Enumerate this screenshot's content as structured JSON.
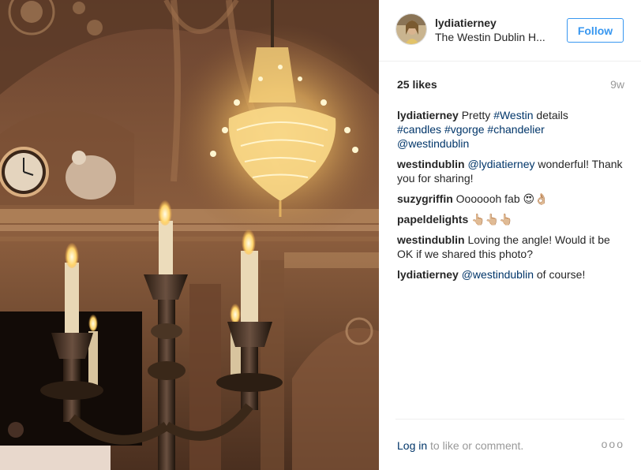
{
  "post": {
    "author": "lydiatierney",
    "location": "The Westin Dublin H...",
    "follow_label": "Follow",
    "likes": "25 likes",
    "age": "9w"
  },
  "caption": {
    "user": "lydiatierney",
    "text_pre": " Pretty ",
    "tag1": "#Westin",
    "text_mid": " details",
    "tag2": "#candles",
    "tag3": "#vgorge",
    "tag4": "#chandelier",
    "mention": "@westindublin"
  },
  "comments": [
    {
      "user": "westindublin",
      "mention": "@lydiatierney",
      "text": " wonderful! Thank you for sharing!"
    },
    {
      "user": "suzygriffin",
      "mention": "",
      "text": " Ooooooh fab 😍👌🏼"
    },
    {
      "user": "papeldelights",
      "mention": "",
      "text": " 👆🏼👆🏼👆🏼"
    },
    {
      "user": "westindublin",
      "mention": "",
      "text": " Loving the angle! Would it be OK if we shared this photo?"
    },
    {
      "user": "lydiatierney",
      "mention": "@westindublin",
      "text": " of course!"
    }
  ],
  "footer": {
    "login_link": "Log in",
    "login_text": " to like or comment.",
    "more": "ooo"
  },
  "colors": {
    "follow_blue": "#3897f0",
    "link_blue": "#003569",
    "muted": "#999999"
  },
  "icons": {
    "more_options": "ellipsis-icon"
  }
}
